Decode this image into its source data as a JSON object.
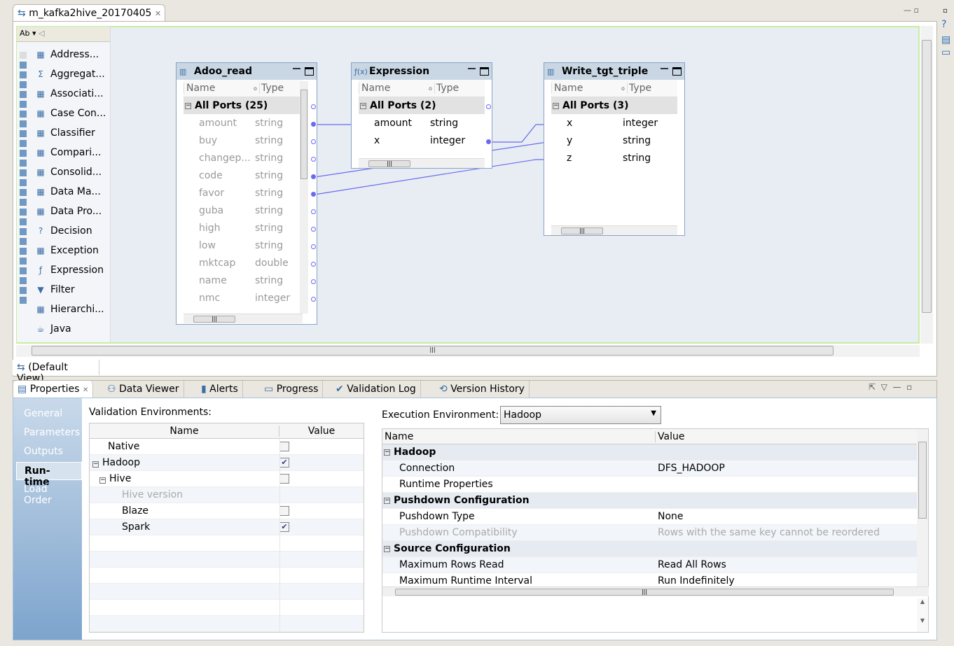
{
  "editor": {
    "tab_title": "m_kafka2hive_20170405",
    "default_view": "(Default View)"
  },
  "palette": {
    "items": [
      {
        "label": "Address...",
        "icon": "address-icon"
      },
      {
        "label": "Aggregat...",
        "icon": "sigma-icon"
      },
      {
        "label": "Associati...",
        "icon": "association-icon"
      },
      {
        "label": "Case Con...",
        "icon": "case-converter-icon"
      },
      {
        "label": "Classifier",
        "icon": "classifier-icon"
      },
      {
        "label": "Compari...",
        "icon": "comparison-icon"
      },
      {
        "label": "Consolid...",
        "icon": "consolidation-icon"
      },
      {
        "label": "Data Ma...",
        "icon": "data-masking-icon"
      },
      {
        "label": "Data Pro...",
        "icon": "data-processor-icon"
      },
      {
        "label": "Decision",
        "icon": "decision-icon"
      },
      {
        "label": "Exception",
        "icon": "exception-icon"
      },
      {
        "label": "Expression",
        "icon": "function-icon"
      },
      {
        "label": "Filter",
        "icon": "filter-icon"
      },
      {
        "label": "Hierarchi...",
        "icon": "hierarchy-icon"
      },
      {
        "label": "Java",
        "icon": "java-icon"
      }
    ]
  },
  "objects": {
    "adoo": {
      "title": "Adoo_read",
      "col_name": "Name",
      "col_type": "Type",
      "group": "All Ports (25)",
      "ports": [
        [
          "amount",
          "string"
        ],
        [
          "buy",
          "string"
        ],
        [
          "changep...",
          "string"
        ],
        [
          "code",
          "string"
        ],
        [
          "favor",
          "string"
        ],
        [
          "guba",
          "string"
        ],
        [
          "high",
          "string"
        ],
        [
          "low",
          "string"
        ],
        [
          "mktcap",
          "double"
        ],
        [
          "name",
          "string"
        ],
        [
          "nmc",
          "integer"
        ]
      ]
    },
    "expr": {
      "title": "Expression",
      "col_name": "Name",
      "col_type": "Type",
      "group": "All Ports (2)",
      "ports": [
        [
          "amount",
          "string"
        ],
        [
          "x",
          "integer"
        ]
      ]
    },
    "write": {
      "title": "Write_tgt_triple",
      "col_name": "Name",
      "col_type": "Type",
      "group": "All Ports (3)",
      "ports": [
        [
          "x",
          "integer"
        ],
        [
          "y",
          "string"
        ],
        [
          "z",
          "string"
        ]
      ]
    }
  },
  "bottom_tabs": [
    "Properties",
    "Data Viewer",
    "Alerts",
    "Progress",
    "Validation Log",
    "Version History"
  ],
  "nav": [
    "General",
    "Parameters",
    "Outputs",
    "Run-time",
    "Load Order"
  ],
  "validation": {
    "label": "Validation Environments:",
    "col_name": "Name",
    "col_value": "Value",
    "rows": [
      {
        "name": "Native",
        "checked": false,
        "indent": 0,
        "toggle": false
      },
      {
        "name": "Hadoop",
        "checked": true,
        "indent": 0,
        "toggle": true
      },
      {
        "name": "Hive",
        "checked": false,
        "indent": 1,
        "toggle": true
      },
      {
        "name": "Hive version",
        "checked": null,
        "indent": 2,
        "toggle": false,
        "dim": true
      },
      {
        "name": "Blaze",
        "checked": false,
        "indent": 2,
        "toggle": false
      },
      {
        "name": "Spark",
        "checked": true,
        "indent": 2,
        "toggle": false
      }
    ]
  },
  "execution": {
    "label": "Execution Environment:",
    "value": "Hadoop",
    "col_name": "Name",
    "col_value": "Value",
    "rows": [
      {
        "section": "Hadoop"
      },
      {
        "name": "Connection",
        "value": "DFS_HADOOP"
      },
      {
        "name": "Runtime Properties",
        "value": ""
      },
      {
        "section": "Pushdown Configuration"
      },
      {
        "name": "Pushdown Type",
        "value": "None"
      },
      {
        "name": "Pushdown Compatibility",
        "value": "Rows with the same key cannot be reordered",
        "dim": true
      },
      {
        "section": "Source Configuration"
      },
      {
        "name": "Maximum Rows Read",
        "value": "Read All Rows"
      },
      {
        "name": "Maximum Runtime Interval",
        "value": "Run Indefinitely"
      }
    ]
  },
  "colors": {
    "link": "#6a6af0",
    "canvas": "#e8edf3",
    "object_header": "#c9d6e4"
  }
}
